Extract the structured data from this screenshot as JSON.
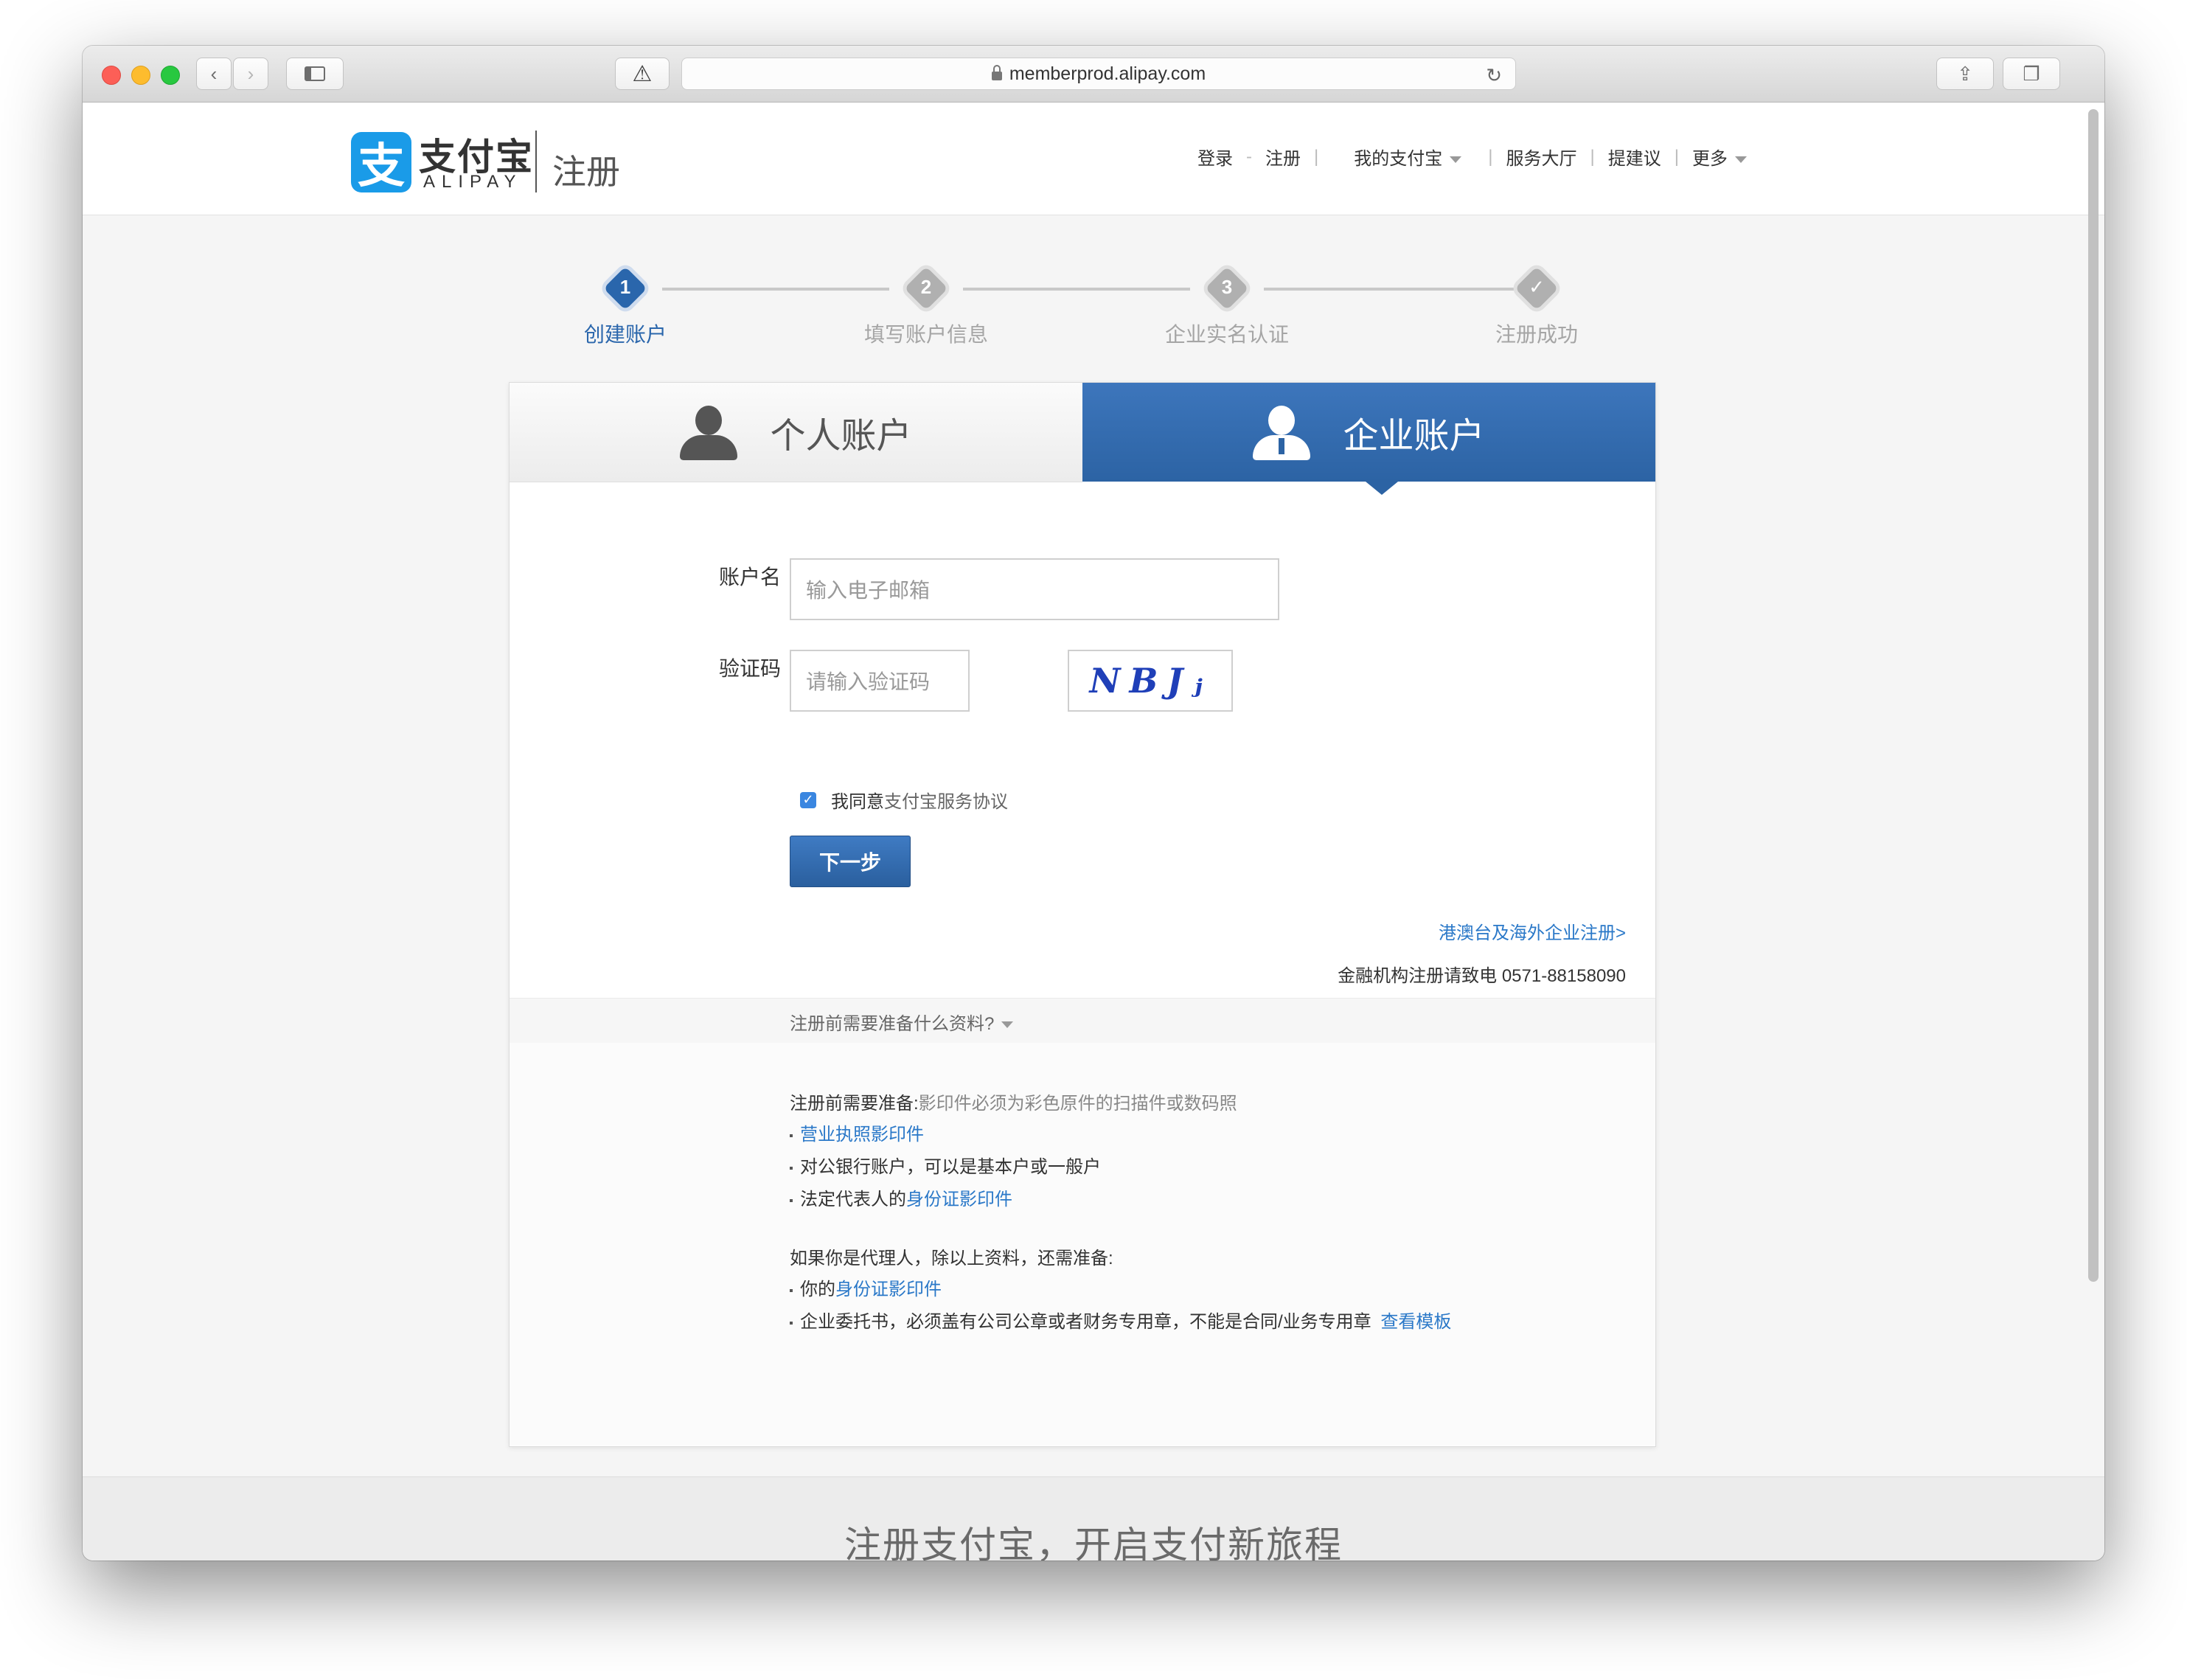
{
  "browser": {
    "url": "memberprod.alipay.com"
  },
  "header": {
    "logo_mark": "支",
    "logo_cn": "支付宝",
    "logo_en": "ALIPAY",
    "logo_sub": "注册",
    "nav": {
      "login": "登录",
      "dash": "-",
      "register": "注册",
      "my_alipay": "我的支付宝",
      "service_hall": "服务大厅",
      "suggest": "提建议",
      "more": "更多"
    }
  },
  "steps": [
    {
      "num": "1",
      "label": "创建账户",
      "active": true
    },
    {
      "num": "2",
      "label": "填写账户信息",
      "active": false
    },
    {
      "num": "3",
      "label": "企业实名认证",
      "active": false
    },
    {
      "num": "✓",
      "label": "注册成功",
      "active": false
    }
  ],
  "tabs": {
    "personal": "个人账户",
    "enterprise": "企业账户",
    "selected": "enterprise"
  },
  "form": {
    "account_label": "账户名",
    "account_placeholder": "输入电子邮箱",
    "captcha_label": "验证码",
    "captcha_placeholder": "请输入验证码",
    "captcha_image_text": "NBJⱼ",
    "agree_prefix": "我同意",
    "agree_link": "支付宝服务协议",
    "agree_checked": true,
    "next_button": "下一步"
  },
  "links": {
    "overseas": "港澳台及海外企业注册>",
    "finance_text": "金融机构注册请致电 0571-88158090"
  },
  "prep": {
    "toggle": "注册前需要准备什么资料?",
    "heading": "注册前需要准备:",
    "heading_note": "影印件必须为彩色原件的扫描件或数码照",
    "item1": "营业执照影印件",
    "item2": "对公银行账户，可以是基本户或一般户",
    "item3_prefix": "法定代表人的",
    "item3_link": "身份证影印件",
    "agent_heading": "如果你是代理人，除以上资料，还需准备:",
    "agent_item1_prefix": "你的",
    "agent_item1_link": "身份证影印件",
    "agent_item2": "企业委托书，必须盖有公司公章或者财务专用章，不能是合同/业务专用章",
    "agent_item2_link": "查看模板"
  },
  "footer": {
    "slogan": "注册支付宝，开启支付新旅程"
  },
  "colors": {
    "brand_blue": "#2c63a4",
    "link_blue": "#2a78c8",
    "logo_blue": "#1a9be8"
  }
}
